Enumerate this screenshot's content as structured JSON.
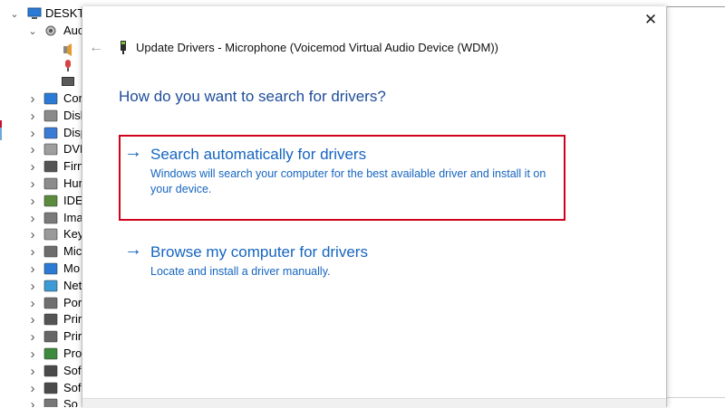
{
  "tree": {
    "root_label": "DESKTO",
    "audio_label": "Auc",
    "items": [
      {
        "label": "Cor",
        "icon": "computer-icon"
      },
      {
        "label": "Disk",
        "icon": "disk-drive-icon"
      },
      {
        "label": "Disp",
        "icon": "display-adapter-icon"
      },
      {
        "label": "DVD",
        "icon": "dvd-drive-icon"
      },
      {
        "label": "Firm",
        "icon": "firmware-icon"
      },
      {
        "label": "Hur",
        "icon": "hid-icon"
      },
      {
        "label": "IDE",
        "icon": "ide-controller-icon"
      },
      {
        "label": "Ima",
        "icon": "imaging-device-icon"
      },
      {
        "label": "Key",
        "icon": "keyboard-icon"
      },
      {
        "label": "Mic",
        "icon": "mouse-icon"
      },
      {
        "label": "Mo",
        "icon": "monitor-icon"
      },
      {
        "label": "Net",
        "icon": "network-adapter-icon"
      },
      {
        "label": "Por",
        "icon": "ports-icon"
      },
      {
        "label": "Prir",
        "icon": "print-queue-icon"
      },
      {
        "label": "Prir",
        "icon": "printer-icon"
      },
      {
        "label": "Pro",
        "icon": "processor-icon"
      },
      {
        "label": "Sof",
        "icon": "software-component-icon"
      },
      {
        "label": "Sof",
        "icon": "software-device-icon"
      },
      {
        "label": "So",
        "icon": "sound-icon"
      }
    ]
  },
  "dialog": {
    "close_glyph": "✕",
    "back_glyph": "←",
    "title": "Update Drivers - Microphone (Voicemod Virtual Audio Device (WDM))",
    "question": "How do you want to search for drivers?",
    "options": [
      {
        "arrow": "→",
        "title": "Search automatically for drivers",
        "description": "Windows will search your computer for the best available driver and install it on your device."
      },
      {
        "arrow": "→",
        "title": "Browse my computer for drivers",
        "description": "Locate and install a driver manually."
      }
    ]
  },
  "colors": {
    "link_blue": "#1565c0",
    "heading_blue": "#1e4d9b",
    "highlight_red": "#d0021b"
  }
}
